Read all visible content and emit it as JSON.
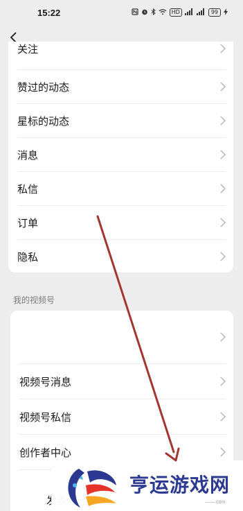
{
  "status_bar": {
    "time": "15:22",
    "icons": [
      "nfc-icon",
      "alarm-icon",
      "bluetooth-icon",
      "wifi-icon",
      "hd-icon",
      "signal-icon",
      "signal-icon"
    ],
    "hd_label": "HD",
    "battery": "99"
  },
  "nav": {
    "back_icon": "chevron-left-icon"
  },
  "card1": {
    "partial_top_label": "关注",
    "items": [
      {
        "label": "赞过的动态"
      },
      {
        "label": "星标的动态"
      },
      {
        "label": "消息"
      },
      {
        "label": "私信"
      },
      {
        "label": "订单"
      },
      {
        "label": "隐私"
      }
    ]
  },
  "section2": {
    "title": "我的视频号",
    "blank_item": "",
    "items": [
      {
        "label": "视频号消息"
      },
      {
        "label": "视频号私信"
      },
      {
        "label": "创作者中心"
      }
    ],
    "partial_bottom_label": "发表"
  },
  "watermark": {
    "text": "亨运游戏网",
    "sub": "——.com"
  },
  "colors": {
    "background": "#ededed",
    "card": "#ffffff",
    "arrow": "#a3362f",
    "watermark_text": "#2b3990"
  }
}
